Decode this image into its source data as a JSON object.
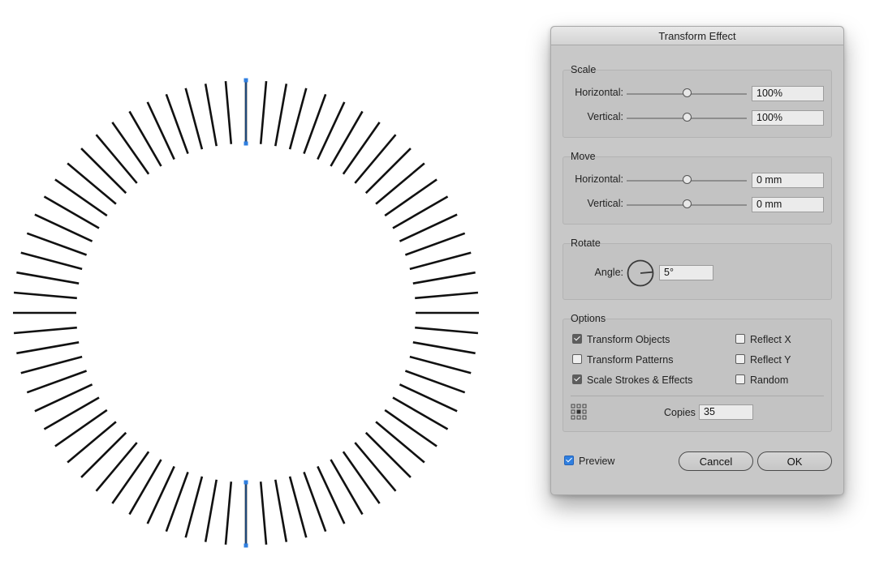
{
  "dialog": {
    "title": "Transform Effect",
    "scale": {
      "label": "Scale",
      "horizontal_label": "Horizontal:",
      "horizontal_value": "100%",
      "vertical_label": "Vertical:",
      "vertical_value": "100%"
    },
    "move": {
      "label": "Move",
      "horizontal_label": "Horizontal:",
      "horizontal_value": "0 mm",
      "vertical_label": "Vertical:",
      "vertical_value": "0 mm"
    },
    "rotate": {
      "label": "Rotate",
      "angle_label": "Angle:",
      "angle_value": "5°"
    },
    "options": {
      "label": "Options",
      "transform_objects": {
        "label": "Transform Objects",
        "checked": true
      },
      "transform_patterns": {
        "label": "Transform Patterns",
        "checked": false
      },
      "scale_strokes": {
        "label": "Scale Strokes & Effects",
        "checked": true
      },
      "reflect_x": {
        "label": "Reflect X",
        "checked": false
      },
      "reflect_y": {
        "label": "Reflect Y",
        "checked": false
      },
      "random": {
        "label": "Random",
        "checked": false
      },
      "copies_label": "Copies",
      "copies_value": "35",
      "reference_point_icon": "reference-point-grid-icon"
    },
    "preview": {
      "label": "Preview",
      "checked": true
    },
    "cancel_label": "Cancel",
    "ok_label": "OK"
  },
  "artwork": {
    "ray_count": 72,
    "ray_color": "#111111",
    "selection_color": "#2f7fe0"
  },
  "colors": {
    "dialog_bg": "#c8c8c8",
    "accent": "#2f7fe0"
  }
}
